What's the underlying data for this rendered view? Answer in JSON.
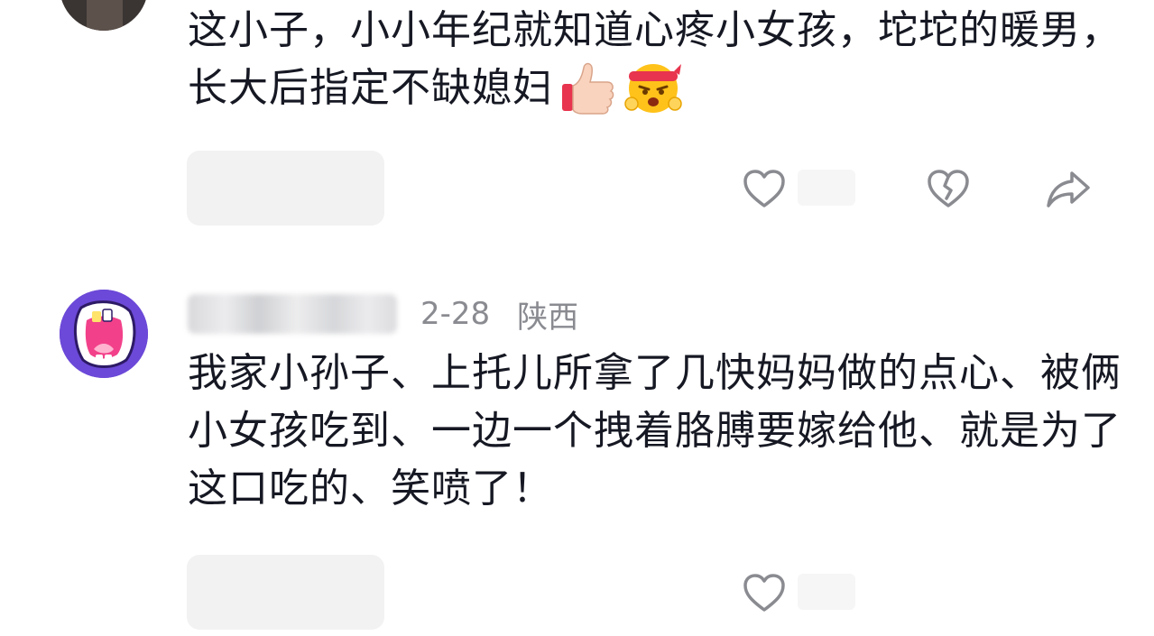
{
  "comments": [
    {
      "text": "这小子，小小年纪就知道心疼小女孩，坨坨的暖男，长大后指定不缺媳妇",
      "emojis": [
        "thumbs-up-emoji",
        "headband-fighting-emoji"
      ],
      "has_dislike": true,
      "has_share": true
    },
    {
      "username": "",
      "date": "2-28",
      "location": "陕西",
      "text": "我家小孙子、上托儿所拿了几快妈妈做的点心、被俩小女孩吃到、一边一个拽着胳膊要嫁给他、就是为了这口吃的、笑喷了！",
      "has_dislike": false,
      "has_share": false
    }
  ],
  "icons": {
    "like": "heart-outline-icon",
    "dislike": "broken-heart-icon",
    "share": "share-arrow-icon"
  },
  "colors": {
    "text": "#161823",
    "meta": "#8a8b91",
    "icon": "#8a8b91",
    "pill": "#f2f2f3",
    "avatar_purple": "#6c49d8"
  }
}
